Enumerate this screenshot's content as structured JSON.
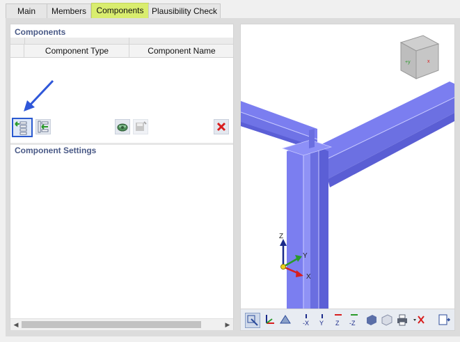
{
  "tabs": [
    {
      "label": "Main",
      "active": false
    },
    {
      "label": "Members",
      "active": false
    },
    {
      "label": "Components",
      "active": true
    },
    {
      "label": "Plausibility Check",
      "active": false
    }
  ],
  "components_section": {
    "title": "Components",
    "columns": [
      "Component Type",
      "Component Name"
    ],
    "rows": []
  },
  "component_settings": {
    "title": "Component Settings"
  },
  "view": {
    "axes": {
      "z": "Z",
      "y": "Y",
      "x": "X"
    },
    "colors": {
      "member": "#7b7ef0",
      "member_dark": "#5b5fd6",
      "selection": "#2a5ad0",
      "delete": "#d81e1e"
    }
  },
  "icons": {
    "left_toolbar": [
      "new-component-icon",
      "insert-component-icon",
      "library-icon",
      "save-to-library-icon",
      "delete-icon"
    ],
    "view_toolbar": [
      "view-selection-icon",
      "axes-icon",
      "render-mode-icon",
      "view-x-icon",
      "view-y-icon",
      "view-z-icon",
      "view-minus-z-icon",
      "solid-icon",
      "transparent-icon",
      "print-icon",
      "reset-icon",
      "exit-view-icon"
    ]
  }
}
